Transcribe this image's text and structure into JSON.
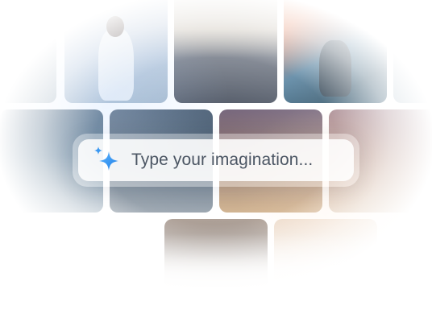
{
  "prompt": {
    "placeholder": "Type your imagination...",
    "icon": "sparkle-icon",
    "icon_color": "#2f8cf0"
  },
  "gallery": {
    "tiles": [
      "photo",
      "photo",
      "photo",
      "photo",
      "photo",
      "photo",
      "photo",
      "photo",
      "photo",
      "photo",
      "photo"
    ]
  }
}
